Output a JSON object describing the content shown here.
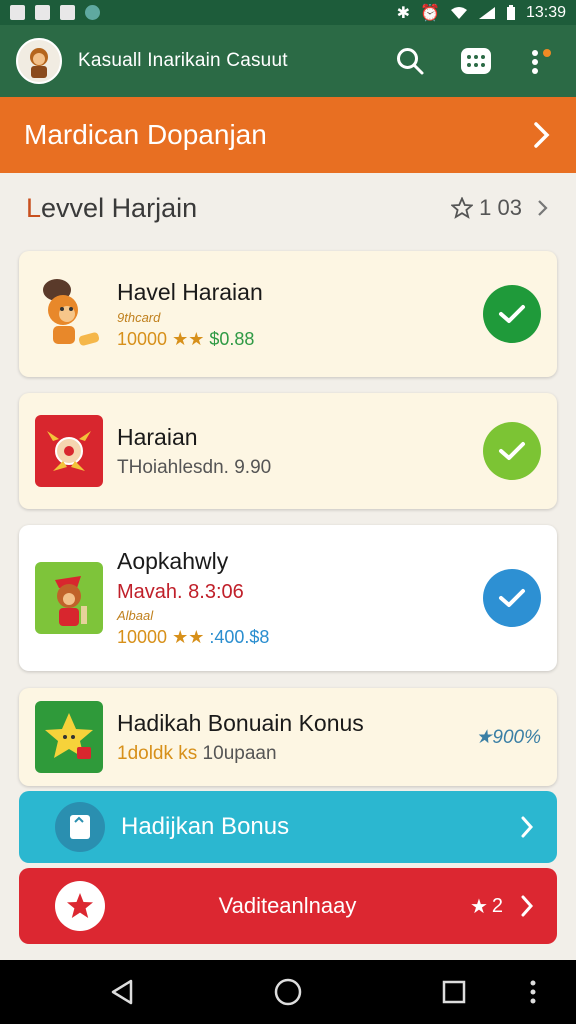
{
  "status_bar": {
    "time": "13:39"
  },
  "app_bar": {
    "title": "Kasuall Inarikain Casuut"
  },
  "banner": {
    "title": "Mardican Dopanjan"
  },
  "level": {
    "title_first": "L",
    "title_rest": "evvel Harjain",
    "meta": "1 03"
  },
  "cards": [
    {
      "title": "Havel Haraian",
      "sub": "9thcard",
      "price_gold": "10000 ",
      "price_alt": "$0.88"
    },
    {
      "title": "Haraian",
      "desc": "THoiahlesdn. 9.90"
    },
    {
      "title": "Aopkahwly",
      "red": "Mavah. 8.3:06",
      "sub": "Albaal",
      "price_gold": "10000 ",
      "price_blue": ":400.$8"
    },
    {
      "title": "Hadikah Bonuain Konus",
      "desc_gold": "1doldk ks",
      "desc_rest": " 10upaan",
      "pct": "900%"
    }
  ],
  "buttons": {
    "bonus": "Hadijkan Bonus",
    "daily": "Vaditeanlnaay",
    "daily_count": "2"
  },
  "colors": {
    "green_dark": "#2b6a45",
    "orange": "#e86f22",
    "teal": "#2bb7d0",
    "red": "#dc2731"
  }
}
